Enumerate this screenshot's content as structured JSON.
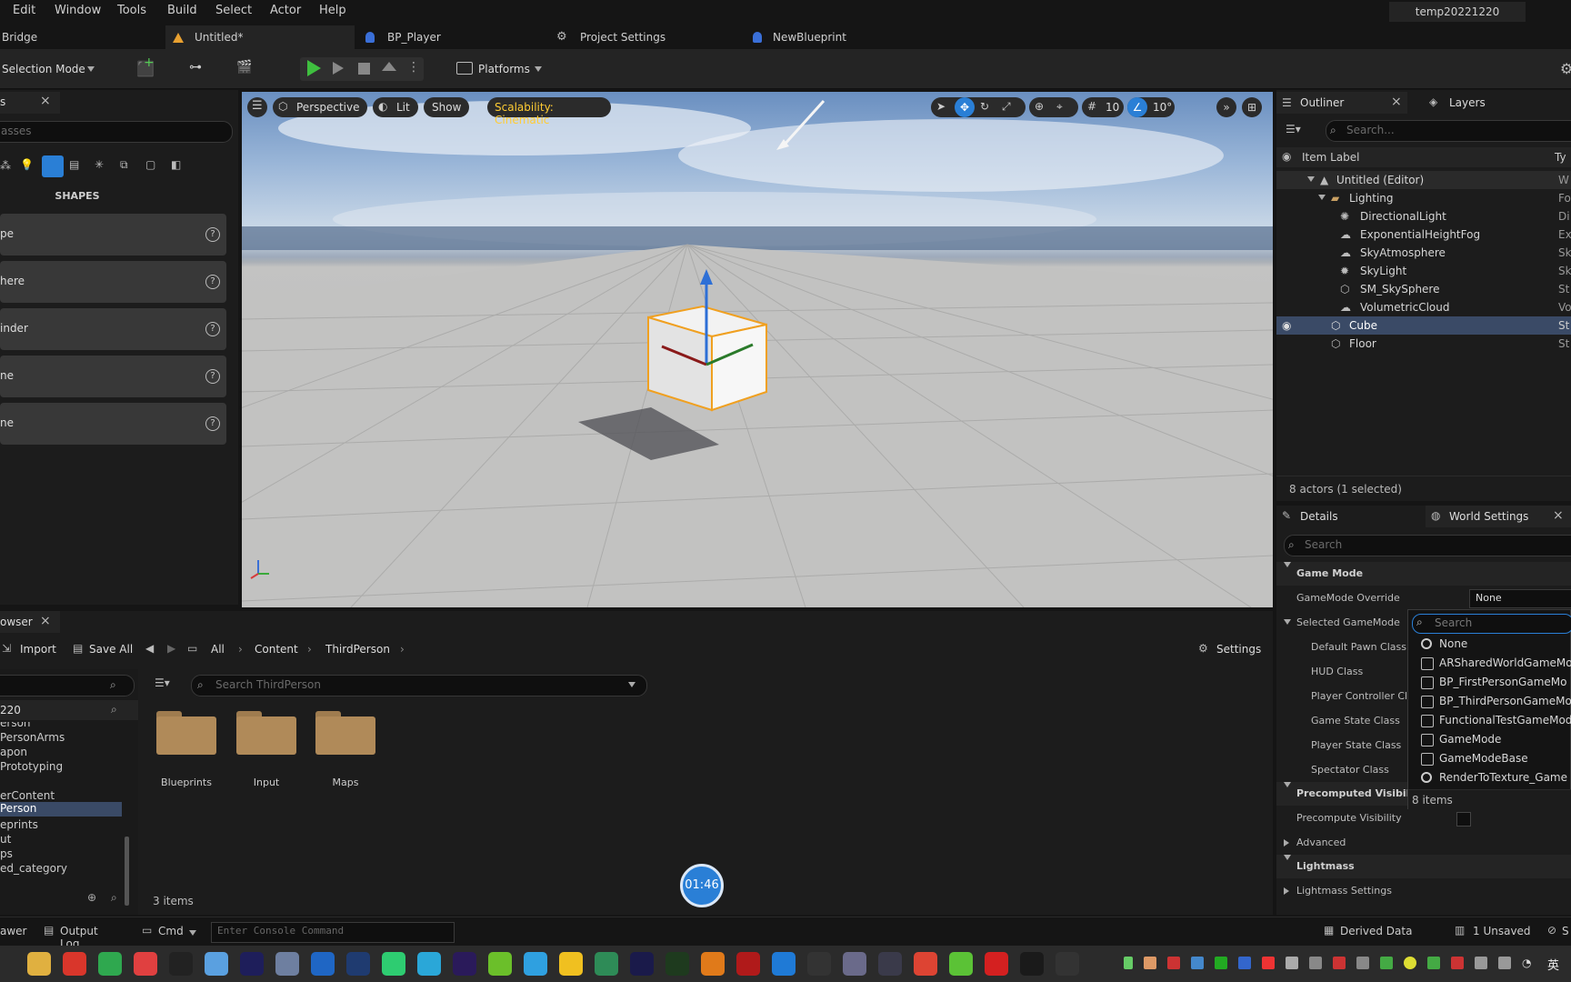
{
  "menu": [
    "Edit",
    "Window",
    "Tools",
    "Build",
    "Select",
    "Actor",
    "Help"
  ],
  "project_name": "temp20221220",
  "tabs": {
    "bridge": "Bridge",
    "untitled": "Untitled*",
    "bp_player": "BP_Player",
    "project_settings": "Project Settings",
    "new_blueprint": "NewBlueprint"
  },
  "toolbar": {
    "selection_mode": "Selection Mode",
    "platforms": "Platforms"
  },
  "place_actors": {
    "tab_label": "s",
    "search_placeholder": "asses",
    "section": "SHAPES",
    "shapes": [
      "pe",
      "here",
      "inder",
      "ne",
      "ne"
    ]
  },
  "viewport": {
    "perspective": "Perspective",
    "lit": "Lit",
    "show": "Show",
    "scalability": "Scalability: Cinematic",
    "grid_snap": "10",
    "rot_snap": "10°"
  },
  "outliner": {
    "tab": "Outliner",
    "layers_tab": "Layers",
    "search_placeholder": "Search...",
    "col_label": "Item Label",
    "col_type": "Ty",
    "items": [
      {
        "label": "Untitled (Editor)",
        "type": "W"
      },
      {
        "label": "Lighting",
        "type": "Fo"
      },
      {
        "label": "DirectionalLight",
        "type": "Di"
      },
      {
        "label": "ExponentialHeightFog",
        "type": "Ex"
      },
      {
        "label": "SkyAtmosphere",
        "type": "Sk"
      },
      {
        "label": "SkyLight",
        "type": "Sk"
      },
      {
        "label": "SM_SkySphere",
        "type": "St"
      },
      {
        "label": "VolumetricCloud",
        "type": "Vo"
      },
      {
        "label": "Cube",
        "type": "St"
      },
      {
        "label": "Floor",
        "type": "St"
      }
    ],
    "status": "8 actors (1 selected)"
  },
  "details": {
    "tab": "Details",
    "world_settings_tab": "World Settings",
    "search_placeholder": "Search",
    "sections": {
      "game_mode": "Game Mode",
      "precomputed": "Precomputed Visibility",
      "advanced": "Advanced",
      "lightmass": "Lightmass"
    },
    "props": {
      "gamemode_override": "GameMode Override",
      "gamemode_override_value": "None",
      "selected_gamemode": "Selected GameMode",
      "default_pawn": "Default Pawn Class",
      "hud": "HUD Class",
      "player_controller": "Player Controller Cla",
      "game_state": "Game State Class",
      "player_state": "Player State Class",
      "spectator": "Spectator Class",
      "precompute_visibility": "Precompute Visibility",
      "lightmass_settings": "Lightmass Settings"
    }
  },
  "dropdown": {
    "search_placeholder": "Search",
    "items": [
      "None",
      "ARSharedWorldGameMo",
      "BP_FirstPersonGameMo",
      "BP_ThirdPersonGameMo",
      "FunctionalTestGameMod",
      "GameMode",
      "GameModeBase",
      "RenderToTexture_Game"
    ],
    "count": "8 items"
  },
  "content_browser": {
    "tab": "owser",
    "import": "Import",
    "save_all": "Save All",
    "breadcrumb": [
      "All",
      "Content",
      "ThirdPerson"
    ],
    "settings": "Settings",
    "search_placeholder": "Search ThirdPerson",
    "tree_root": "220",
    "tree": [
      "erson",
      "PersonArms",
      "apon",
      "Prototyping",
      "",
      "erContent",
      "Person",
      "eprints",
      "ut",
      "ps",
      "ed_category"
    ],
    "folders": [
      "Blueprints",
      "Input",
      "Maps"
    ],
    "items_count": "3 items"
  },
  "timer": "01:46",
  "status_bar": {
    "drawer": "awer",
    "output_log": "Output Log",
    "cmd": "Cmd",
    "console_placeholder": "Enter Console Command",
    "derived_data": "Derived Data",
    "unsaved": "1 Unsaved",
    "s": "S"
  },
  "taskbar": {
    "ime": "英",
    "apps": [
      "explorer",
      "wps",
      "chrome-green",
      "files",
      "qq",
      "baidu",
      "ae",
      "app1",
      "app2",
      "ps",
      "app3",
      "app4",
      "pr",
      "app5",
      "app6",
      "app7",
      "app8",
      "au",
      "pt",
      "blender",
      "solidworks",
      "vscode",
      "typora",
      "calc",
      "app9",
      "chrome",
      "iqiyi",
      "youdao",
      "unreal",
      "epic"
    ]
  },
  "colors": {
    "accent": "#2a7fd6",
    "selected_row": "#3a4a66",
    "folder": "#b08a59",
    "scalability": "#ffcc33"
  }
}
